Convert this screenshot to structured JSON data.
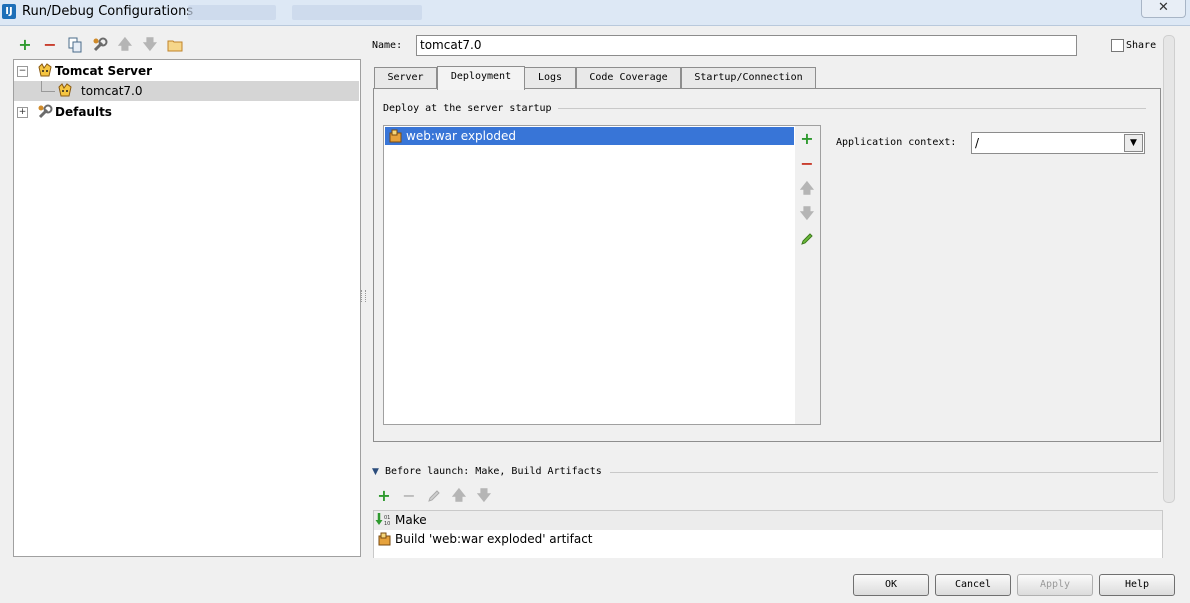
{
  "window": {
    "title": "Run/Debug Configurations",
    "app_icon": "IJ",
    "close_glyph": "✕"
  },
  "left_toolbar": {
    "icons": [
      "add-icon",
      "remove-icon",
      "copy-icon",
      "wrench-icon",
      "arrow-up-icon",
      "arrow-down-icon",
      "folder-icon"
    ]
  },
  "tree": {
    "items": [
      {
        "label": "Tomcat Server",
        "expander": "−",
        "icon": "tomcat-icon"
      },
      {
        "label": "tomcat7.0",
        "icon": "tomcat-icon"
      },
      {
        "label": "Defaults",
        "expander": "+",
        "icon": "wrench-icon"
      }
    ]
  },
  "form": {
    "name_label": "Name:",
    "name_value": "tomcat7.0",
    "share_label": "Share"
  },
  "tabs": [
    {
      "label": "Server"
    },
    {
      "label": "Deployment"
    },
    {
      "label": "Logs"
    },
    {
      "label": "Code Coverage"
    },
    {
      "label": "Startup/Connection"
    }
  ],
  "active_tab": "Deployment",
  "deployment": {
    "legend": "Deploy at the server startup",
    "items": [
      "web:war exploded"
    ],
    "side_icons": [
      "add-icon",
      "remove-icon",
      "arrow-up-icon",
      "arrow-down-icon",
      "edit-icon"
    ],
    "app_context_label": "Application context:",
    "app_context_value": "/"
  },
  "before_launch": {
    "label": "Before launch: Make, Build Artifacts",
    "toolbar_icons": [
      "add-icon",
      "remove-icon",
      "edit-icon",
      "arrow-up-icon",
      "arrow-down-icon"
    ],
    "items": [
      {
        "label": "Make",
        "icon": "make-icon"
      },
      {
        "label": "Build 'web:war exploded' artifact",
        "icon": "artifact-icon"
      }
    ]
  },
  "buttons": {
    "ok": "OK",
    "cancel": "Cancel",
    "apply": "Apply",
    "help": "Help"
  },
  "colors": {
    "selection": "#3875d7",
    "add": "#2f9a2f",
    "remove": "#c83a2a"
  }
}
